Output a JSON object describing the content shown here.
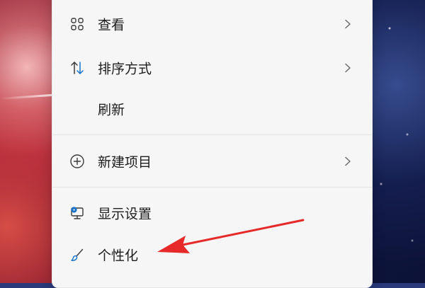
{
  "menu": {
    "items": [
      {
        "label": "查看",
        "icon": "grid-icon",
        "has_submenu": true
      },
      {
        "label": "排序方式",
        "icon": "sort-icon",
        "has_submenu": true
      },
      {
        "label": "刷新",
        "icon": "",
        "has_submenu": false
      },
      {
        "label": "新建项目",
        "icon": "add-circle-icon",
        "has_submenu": true
      },
      {
        "label": "显示设置",
        "icon": "display-settings-icon",
        "has_submenu": false
      },
      {
        "label": "个性化",
        "icon": "paintbrush-icon",
        "has_submenu": false
      }
    ]
  },
  "colors": {
    "menu_background": "#f6f6f6",
    "accent_blue": "#1a73c8",
    "annotation_red": "#e62a2a"
  }
}
